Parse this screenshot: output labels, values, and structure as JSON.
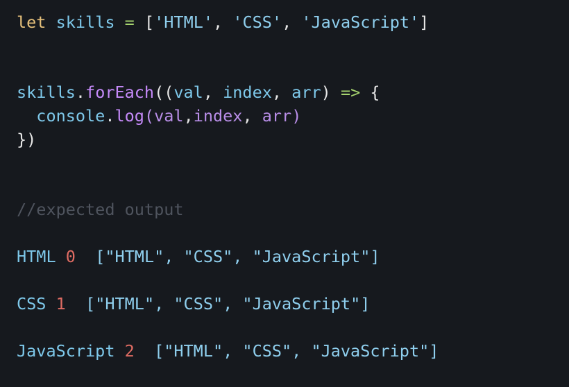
{
  "code": {
    "line1": {
      "keyword": "let",
      "var": "skills",
      "op": "=",
      "open": "[",
      "s1": "'HTML'",
      "comma1": ",",
      "s2": "'CSS'",
      "comma2": ",",
      "s3": "'JavaScript'",
      "close": "]"
    },
    "line2": {
      "obj": "skills",
      "dot": ".",
      "method": "forEach",
      "open": "((",
      "p1": "val",
      "c1": ", ",
      "p2": "index",
      "c2": ", ",
      "p3": "arr",
      "close": ")",
      "arrow": "=>",
      "brace": "{"
    },
    "line3": {
      "obj": "console",
      "dot": ".",
      "method": "log",
      "open": "(",
      "a1": "val",
      "c1": ",",
      "a2": "index",
      "c2": ", ",
      "a3": "arr",
      "close": ")"
    },
    "line4": "})",
    "comment": "//expected output"
  },
  "output": [
    {
      "value": "HTML",
      "index": "0",
      "array": "[\"HTML\", \"CSS\", \"JavaScript\"]"
    },
    {
      "value": "CSS",
      "index": "1",
      "array": "[\"HTML\", \"CSS\", \"JavaScript\"]"
    },
    {
      "value": "JavaScript",
      "index": "2",
      "array": "[\"HTML\", \"CSS\", \"JavaScript\"]"
    }
  ],
  "colors": {
    "background": "#16191e",
    "keyword": "#e5c07b",
    "variable": "#7ec8ea",
    "string": "#8fcfee",
    "method": "#c58af9",
    "comment": "#4f545e",
    "number": "#e06c63",
    "operator": "#a6d46f"
  }
}
